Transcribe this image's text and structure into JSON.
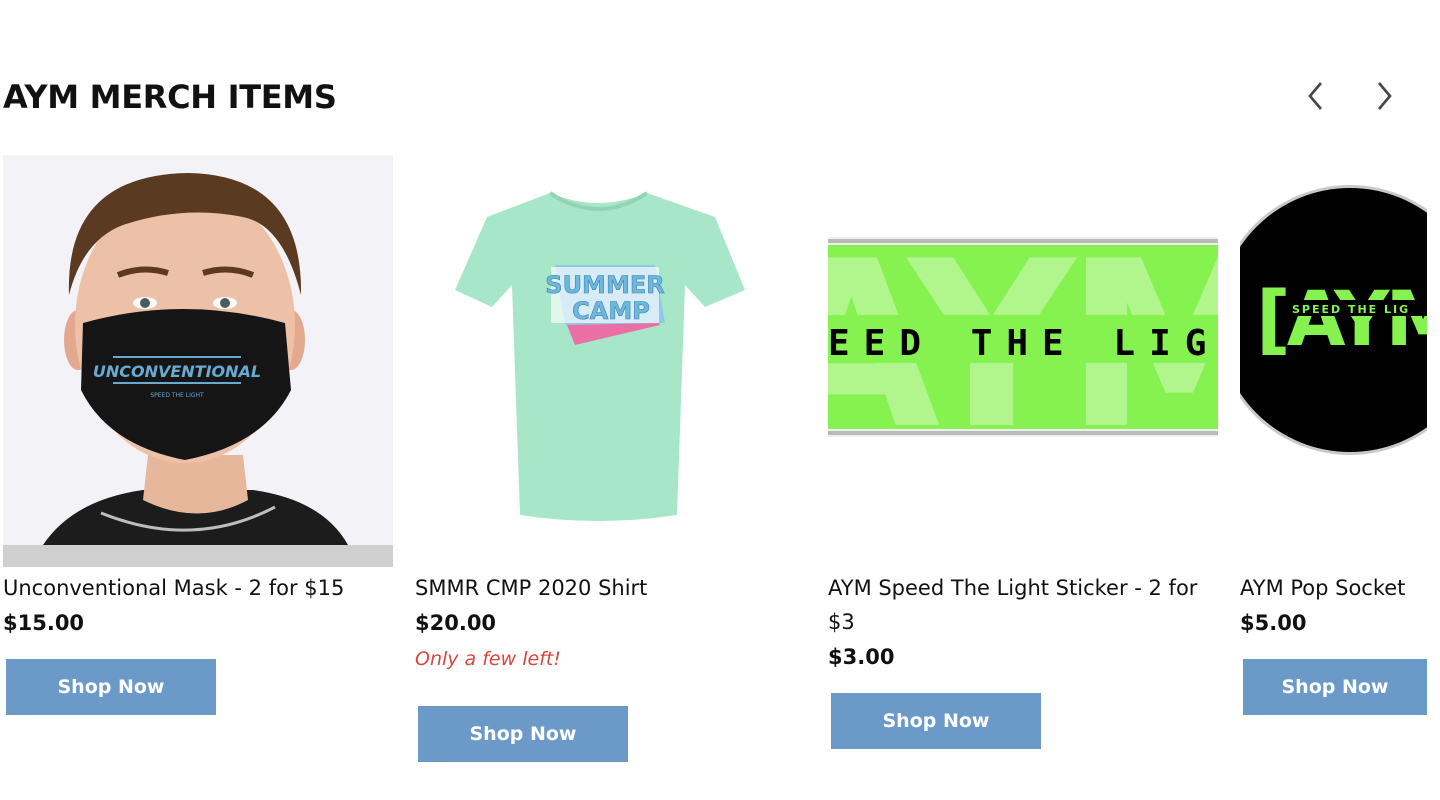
{
  "section": {
    "title": "AYM MERCH ITEMS",
    "prev_icon": "chevron-left-icon",
    "next_icon": "chevron-right-icon"
  },
  "products": [
    {
      "name": "Unconventional Mask - 2 for $15",
      "price": "$15.00",
      "button": "Shop Now",
      "image": {
        "kind": "mask-photo",
        "mask_text": "UNCONVENTIONAL",
        "mask_subtext": "SPEED THE LIGHT"
      }
    },
    {
      "name": "SMMR CMP 2020 Shirt",
      "price": "$20.00",
      "stock_note": "Only a few left!",
      "button": "Shop Now",
      "image": {
        "kind": "tshirt",
        "print_line1": "SUMMER",
        "print_line2": "CAMP"
      }
    },
    {
      "name_line1": "AYM Speed The Light Sticker - 2 for",
      "name_line2": "$3",
      "price": "$3.00",
      "button": "Shop Now",
      "image": {
        "kind": "sticker",
        "big_text": "AYM",
        "band_text": "EED THE LIG"
      }
    },
    {
      "name": "AYM Pop Socket",
      "price": "$5.00",
      "button": "Shop Now",
      "image": {
        "kind": "popsocket",
        "big_text": "[AYM",
        "small_text": "SPEED THE LIG"
      }
    }
  ],
  "colors": {
    "button": "#6b9ac9",
    "stock_warning": "#d9463e",
    "neon_green": "#86f24f",
    "shirt": "#a8e6c9"
  }
}
